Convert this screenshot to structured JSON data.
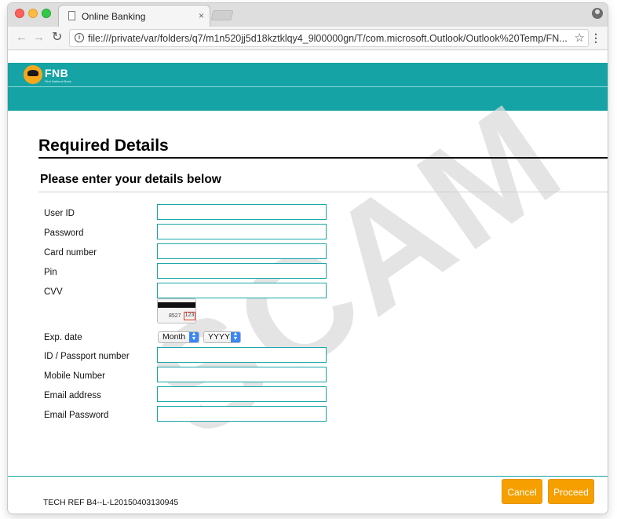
{
  "browser": {
    "tab_title": "Online Banking",
    "tab_close": "×",
    "url": "file:///private/var/folders/q7/m1n520jj5d18kztklqy4_9l00000gn/T/com.microsoft.Outlook/Outlook%20Temp/FN...",
    "nav": {
      "back": "←",
      "forward": "→",
      "reload": "C",
      "star": "☆",
      "menu": "⋮"
    }
  },
  "header": {
    "brand": "FNB",
    "tagline": "First National Bank",
    "accent_color": "#16a3a5"
  },
  "watermark": "SCAM",
  "form": {
    "title": "Required Details",
    "subtitle": "Please enter your details below",
    "fields": [
      {
        "label": "User ID",
        "value": ""
      },
      {
        "label": "Password",
        "value": ""
      },
      {
        "label": "Card number",
        "value": ""
      },
      {
        "label": "Pin",
        "value": ""
      },
      {
        "label": "CVV",
        "value": ""
      }
    ],
    "cvv_card": {
      "digits": "8527",
      "cvv": "123"
    },
    "exp_date": {
      "label": "Exp. date",
      "month": "Month",
      "year": "YYYY"
    },
    "fields2": [
      {
        "label": "ID / Passport number",
        "value": ""
      },
      {
        "label": "Mobile Number",
        "value": ""
      },
      {
        "label": "Email address",
        "value": ""
      },
      {
        "label": "Email Password",
        "value": ""
      }
    ]
  },
  "footer": {
    "tech_ref": "TECH REF B4--L-L20150403130945",
    "cancel_label": "Cancel",
    "proceed_label": "Proceed",
    "button_color": "#f5a000"
  }
}
